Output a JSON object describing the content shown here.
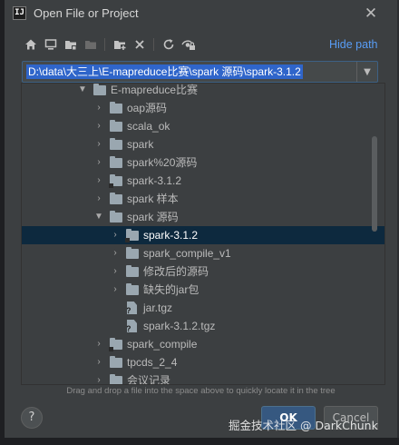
{
  "window": {
    "app_logo_text": "IJ",
    "title": "Open File or Project",
    "close_symbol": "✕"
  },
  "toolbar": {
    "buttons": [
      {
        "icon": "home-icon",
        "glyph": "⌂",
        "enabled": true
      },
      {
        "icon": "desktop-icon",
        "glyph": "▭",
        "enabled": true
      },
      {
        "icon": "project-folder-icon",
        "glyph": "▆",
        "enabled": true
      },
      {
        "icon": "module-folder-icon",
        "glyph": "▆",
        "enabled": false
      },
      {
        "icon": "new-folder-icon",
        "glyph": "▆",
        "enabled": true
      },
      {
        "icon": "delete-icon",
        "glyph": "✕",
        "enabled": true
      },
      {
        "icon": "refresh-icon",
        "glyph": "↻",
        "enabled": true
      },
      {
        "icon": "show-hidden-icon",
        "glyph": "◉",
        "enabled": true
      }
    ],
    "hide_path_label": "Hide path"
  },
  "path_field": {
    "value": "D:\\data\\大三上\\E-mapreduce比赛\\spark 源码\\spark-3.1.2",
    "dropdown_symbol": "▼"
  },
  "tree": {
    "rows": [
      {
        "label": "E-mapreduce比赛",
        "level": 0,
        "arrow": "▼",
        "icon": "folder",
        "selected": false
      },
      {
        "label": "oap源码",
        "level": 1,
        "arrow": "›",
        "icon": "folder",
        "selected": false
      },
      {
        "label": "scala_ok",
        "level": 1,
        "arrow": "›",
        "icon": "folder",
        "selected": false
      },
      {
        "label": "spark",
        "level": 1,
        "arrow": "›",
        "icon": "folder",
        "selected": false
      },
      {
        "label": "spark%20源码",
        "level": 1,
        "arrow": "›",
        "icon": "folder",
        "selected": false
      },
      {
        "label": "spark-3.1.2",
        "level": 1,
        "arrow": "›",
        "icon": "folder-special",
        "selected": false
      },
      {
        "label": "spark 样本",
        "level": 1,
        "arrow": "›",
        "icon": "folder",
        "selected": false
      },
      {
        "label": "spark 源码",
        "level": 1,
        "arrow": "▼",
        "icon": "folder",
        "selected": false
      },
      {
        "label": "spark-3.1.2",
        "level": 2,
        "arrow": "›",
        "icon": "folder-special",
        "selected": true
      },
      {
        "label": "spark_compile_v1",
        "level": 2,
        "arrow": "›",
        "icon": "folder",
        "selected": false
      },
      {
        "label": "修改后的源码",
        "level": 2,
        "arrow": "›",
        "icon": "folder",
        "selected": false
      },
      {
        "label": "缺失的jar包",
        "level": 2,
        "arrow": "›",
        "icon": "folder",
        "selected": false
      },
      {
        "label": "jar.tgz",
        "level": 2,
        "arrow": "",
        "icon": "file",
        "selected": false
      },
      {
        "label": "spark-3.1.2.tgz",
        "level": 2,
        "arrow": "",
        "icon": "file",
        "selected": false
      },
      {
        "label": "spark_compile",
        "level": 1,
        "arrow": "›",
        "icon": "folder-special",
        "selected": false
      },
      {
        "label": "tpcds_2_4",
        "level": 1,
        "arrow": "›",
        "icon": "folder",
        "selected": false
      },
      {
        "label": "会议记录",
        "level": 1,
        "arrow": "›",
        "icon": "folder",
        "selected": false
      }
    ]
  },
  "hint": "Drag and drop a file into the space above to quickly locate it in the tree",
  "buttons": {
    "help": "?",
    "ok": "OK",
    "cancel": "Cancel"
  },
  "watermark": "掘金技术社区 @ DarkChunk",
  "colors": {
    "dialog_bg": "#3c3f41",
    "selection": "#0d293e",
    "path_highlight": "#2f65ca",
    "link": "#589df6",
    "ok_button": "#365880"
  }
}
